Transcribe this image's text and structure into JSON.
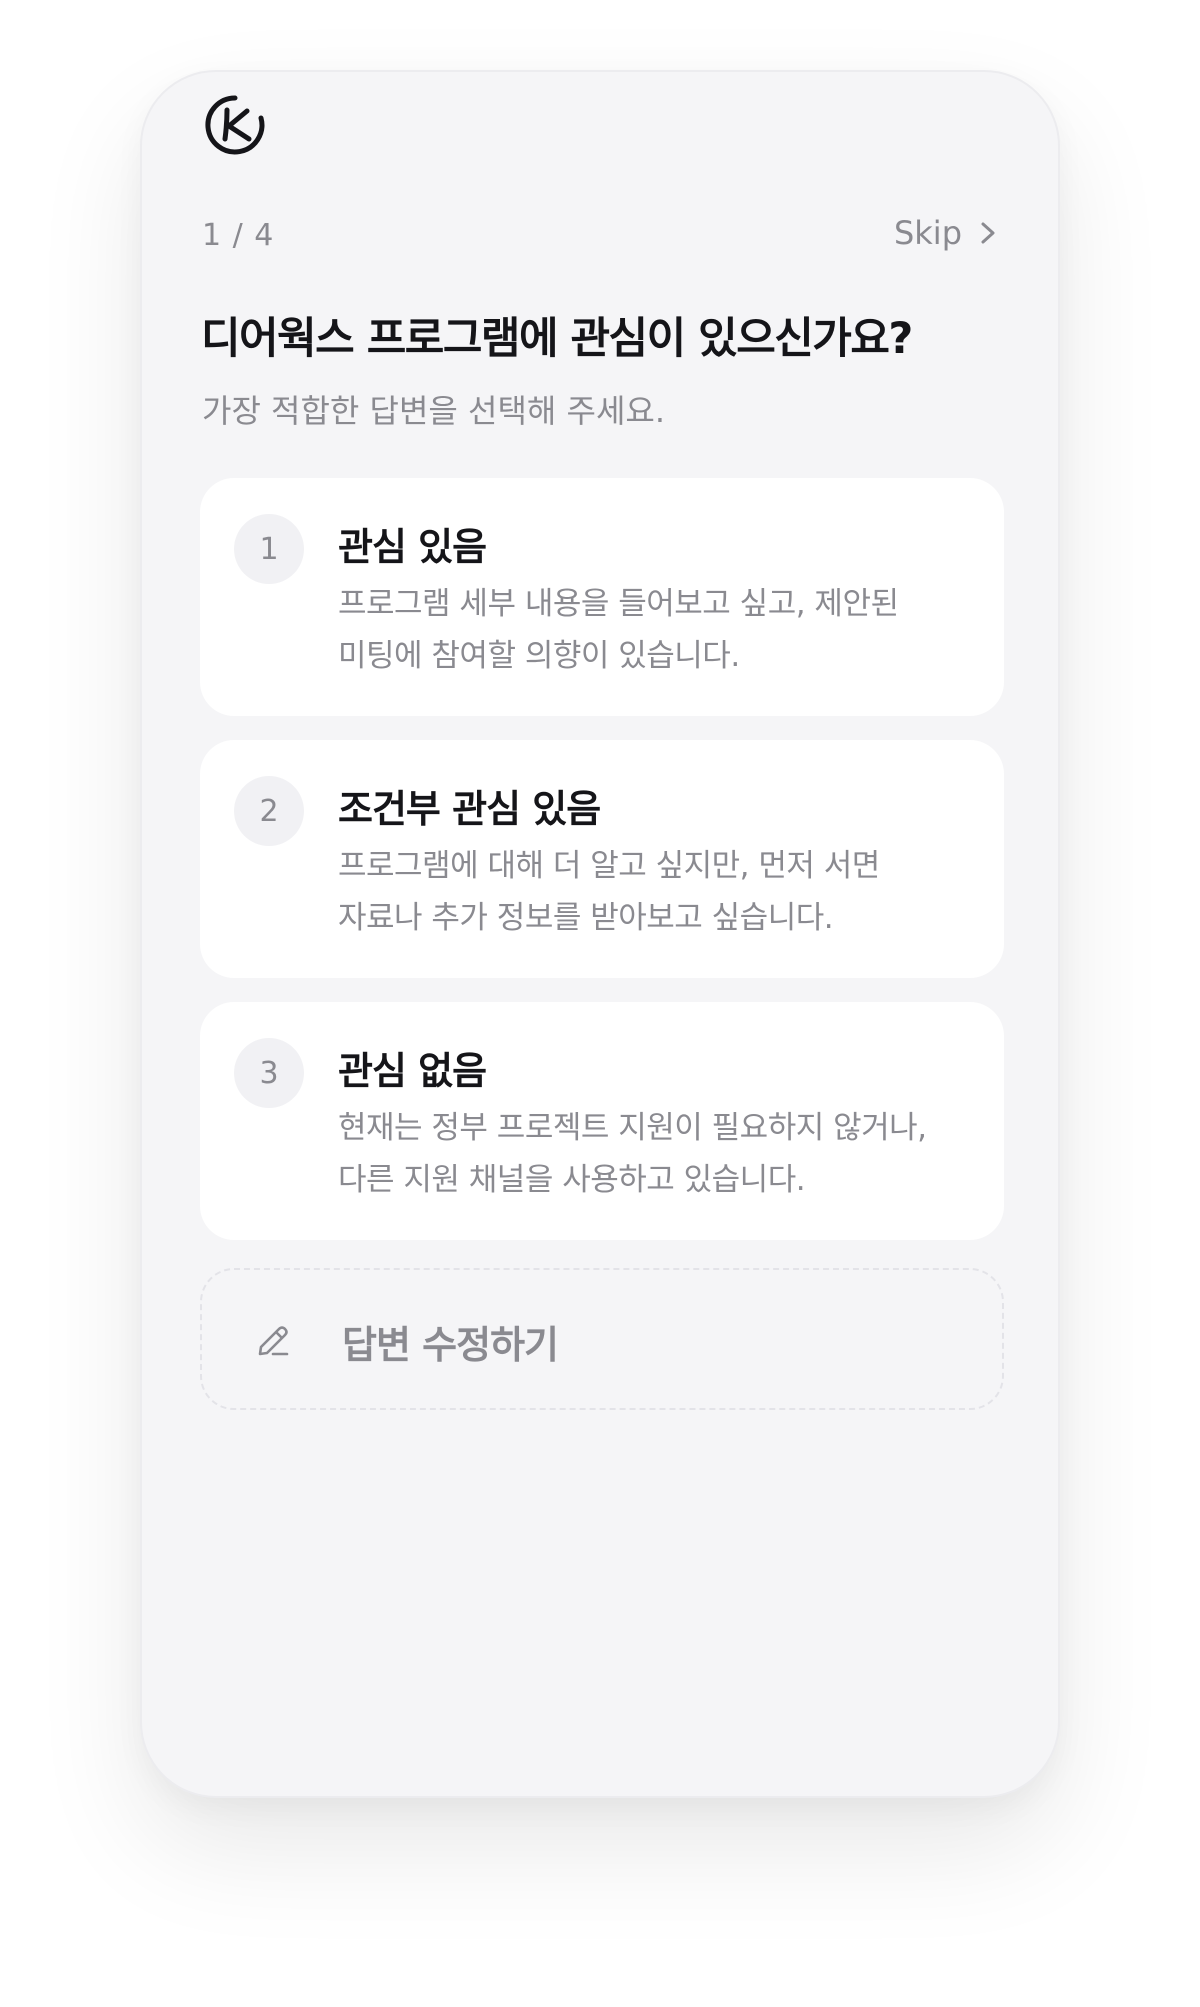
{
  "header": {
    "logo_icon": "k-circle-logo-icon",
    "progress": "1 / 4",
    "skip_label": "Skip"
  },
  "question": {
    "title": "디어웍스 프로그램에 관심이 있으신가요?",
    "subtitle": "가장 적합한 답변을 선택해 주세요."
  },
  "options": [
    {
      "number": "1",
      "title": "관심 있음",
      "description": "프로그램 세부 내용을 들어보고 싶고, 제안된 미팅에 참여할 의향이 있습니다."
    },
    {
      "number": "2",
      "title": "조건부 관심 있음",
      "description": "프로그램에 대해 더 알고 싶지만, 먼저 서면 자료나 추가 정보를 받아보고 싶습니다."
    },
    {
      "number": "3",
      "title": "관심 없음",
      "description": "현재는 정부 프로젝트 지원이 필요하지 않거나, 다른 지원 채널을 사용하고 있습니다."
    }
  ],
  "edit_answer": {
    "icon": "pencil-icon",
    "label": "답변 수정하기"
  },
  "colors": {
    "screen_background": "#f5f5f7",
    "card_background": "#ffffff",
    "text_primary": "#151519",
    "text_secondary": "#8a8a90",
    "number_badge": "#f1f1f4",
    "dashed_border": "#e3e3e8"
  }
}
